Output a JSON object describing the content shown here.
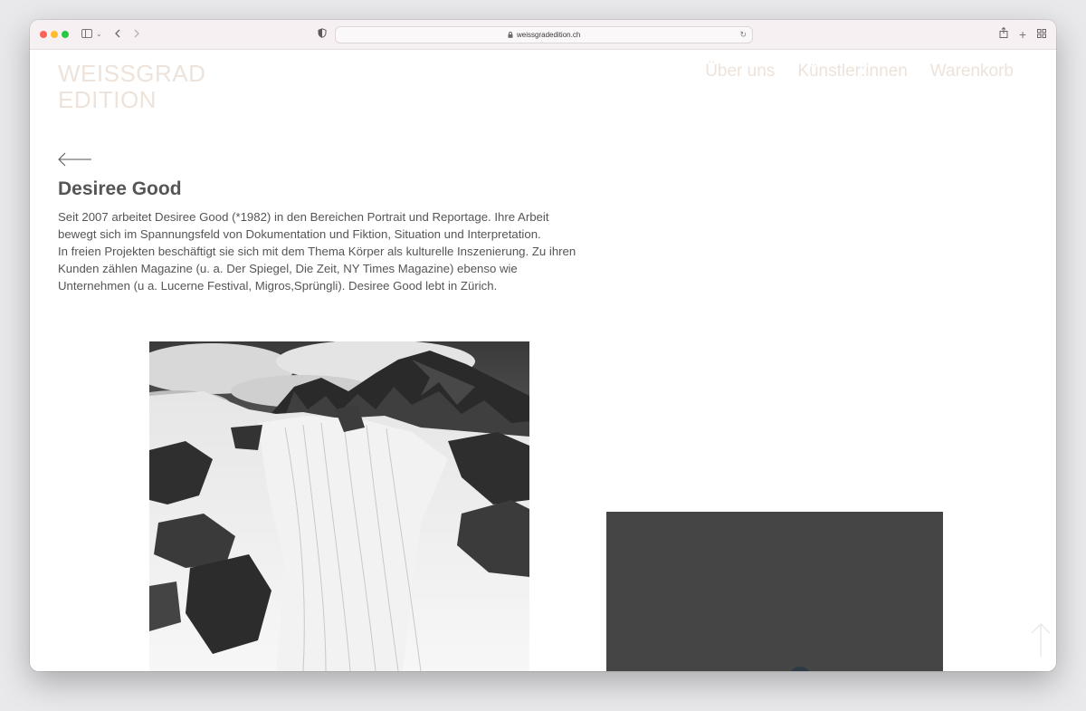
{
  "browser": {
    "url": "weissgradedition.ch",
    "icons": [
      "traffic-lights",
      "sidebar-icon",
      "chevron-down-icon",
      "back-icon",
      "forward-icon",
      "privacy-shield-icon",
      "lock-icon",
      "reload-icon",
      "share-icon",
      "new-tab-icon",
      "tab-overview-icon"
    ]
  },
  "site": {
    "logo_line1": "WEISSGRAD",
    "logo_line2": "EDITION",
    "nav": [
      {
        "label": "Über uns"
      },
      {
        "label": "Künstler:innen"
      },
      {
        "label": "Warenkorb"
      }
    ],
    "accent_color": "#ede3db"
  },
  "artist": {
    "name": "Desiree Good",
    "bio_paragraph_1": "Seit 2007 arbeitet Desiree Good (*1982) in den Bereichen Portrait und Reportage. Ihre Arbeit bewegt sich im Spannungsfeld von Dokumentation und Fiktion, Situation und Interpretation.",
    "bio_paragraph_2": "In freien Projekten beschäftigt sie sich mit dem Thema Körper als kulturelle Inszenierung. Zu ihren Kunden zählen Magazine (u. a. Der Spiegel, Die Zeit, NY Times Magazine) ebenso wie Unternehmen (u a. Lucerne Festival, Migros,Sprüngli). Desiree Good lebt in Zürich."
  }
}
